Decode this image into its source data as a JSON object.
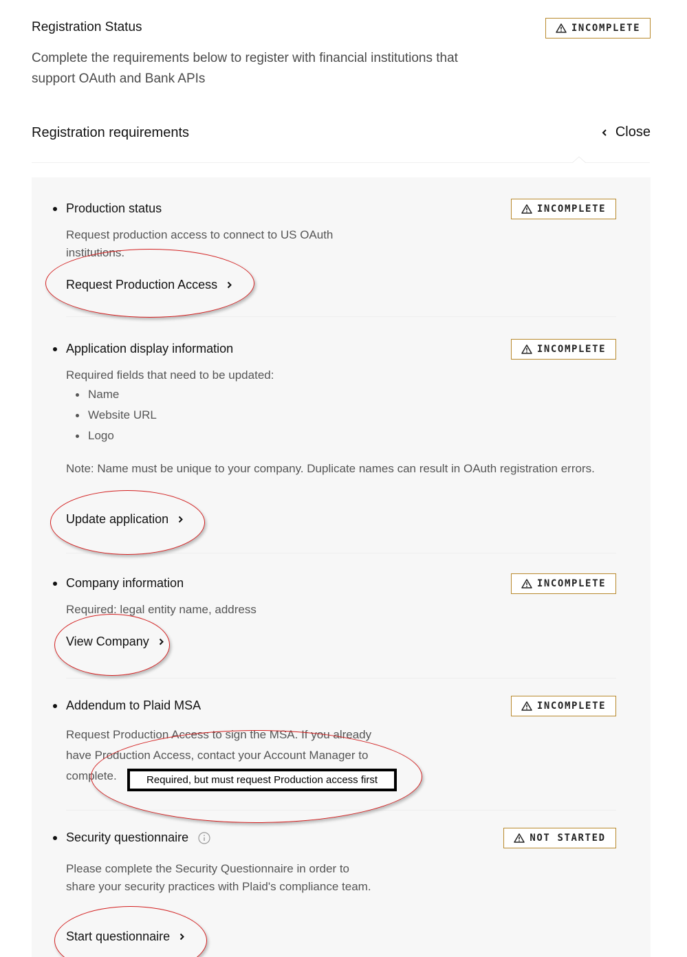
{
  "header": {
    "title": "Registration Status",
    "status": "INCOMPLETE",
    "description": "Complete the requirements below to register with financial institutions that support OAuth and Bank APIs"
  },
  "requirements": {
    "title": "Registration requirements",
    "close_label": "Close",
    "items": [
      {
        "title": "Production status",
        "status": "INCOMPLETE",
        "description": "Request production access to connect to US OAuth institutions.",
        "action": "Request Production Access"
      },
      {
        "title": "Application display information",
        "status": "INCOMPLETE",
        "description": "Required fields that need to be updated:",
        "fields": [
          "Name",
          "Website URL",
          "Logo"
        ],
        "note": "Note: Name must be unique to your company. Duplicate names can result in OAuth registration errors.",
        "action": "Update application"
      },
      {
        "title": "Company information",
        "status": "INCOMPLETE",
        "description": "Required: legal entity name, address",
        "action": "View Company"
      },
      {
        "title": "Addendum to Plaid MSA",
        "status": "INCOMPLETE",
        "description": "Request Production Access to sign the MSA. If you already have Production Access, contact your Account Manager to complete."
      },
      {
        "title": "Security questionnaire",
        "status": "NOT STARTED",
        "description": "Please complete the Security Questionnaire in order to share your security practices with Plaid's compliance team.",
        "action": "Start questionnaire"
      }
    ]
  },
  "annotation": {
    "label": "Required, but must request Production access first",
    "color": "#d42020"
  },
  "colors": {
    "badge_border": "#b8892c",
    "panel_bg": "#f7f7f7"
  }
}
